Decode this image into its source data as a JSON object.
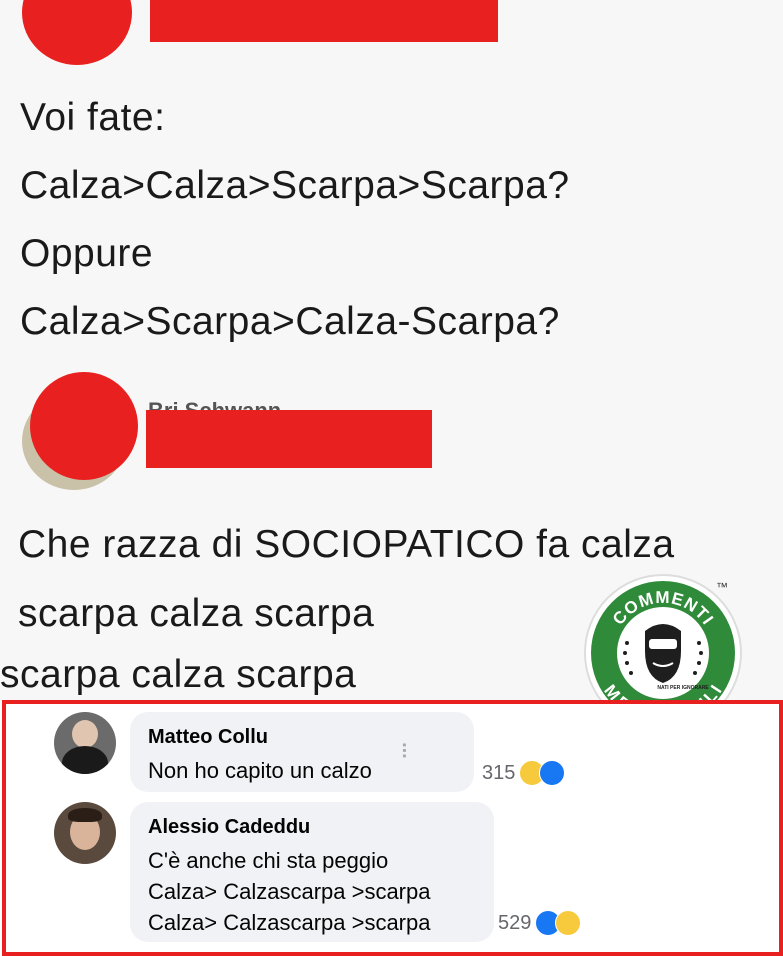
{
  "post": {
    "lines": [
      "Voi fate:",
      "Calza>Calza>Scarpa>Scarpa?",
      "Oppure",
      "Calza>Scarpa>Calza-Scarpa?"
    ]
  },
  "reply": {
    "partial_name": "Bri Schwann",
    "lines": [
      "Che razza di SOCIOPATICO fa calza",
      "scarpa calza scarpa",
      "scarpa calza scarpa"
    ]
  },
  "logo": {
    "top_text": "COMMENTI",
    "bottom_text": "MEMORABILI",
    "tagline": "NATI PER IGNORARE",
    "trademark": "™"
  },
  "comments": [
    {
      "name": "Matteo Collu",
      "lines": [
        "Non ho capito un calzo"
      ],
      "reaction_count": "315",
      "reaction_icons": [
        "haha-icon",
        "like-icon"
      ]
    },
    {
      "name": "Alessio Cadeddu",
      "lines": [
        "C'è anche chi sta peggio",
        "Calza> Calzascarpa >scarpa",
        "Calza> Calzascarpa >scarpa"
      ],
      "reaction_count": "529",
      "reaction_icons": [
        "like-icon",
        "haha-icon"
      ]
    }
  ],
  "colors": {
    "redaction": "#e8201f",
    "logo_green": "#2f8a3a",
    "bubble": "#f0f2f5",
    "like_blue": "#1877f2",
    "haha_yellow": "#f7c93c"
  }
}
